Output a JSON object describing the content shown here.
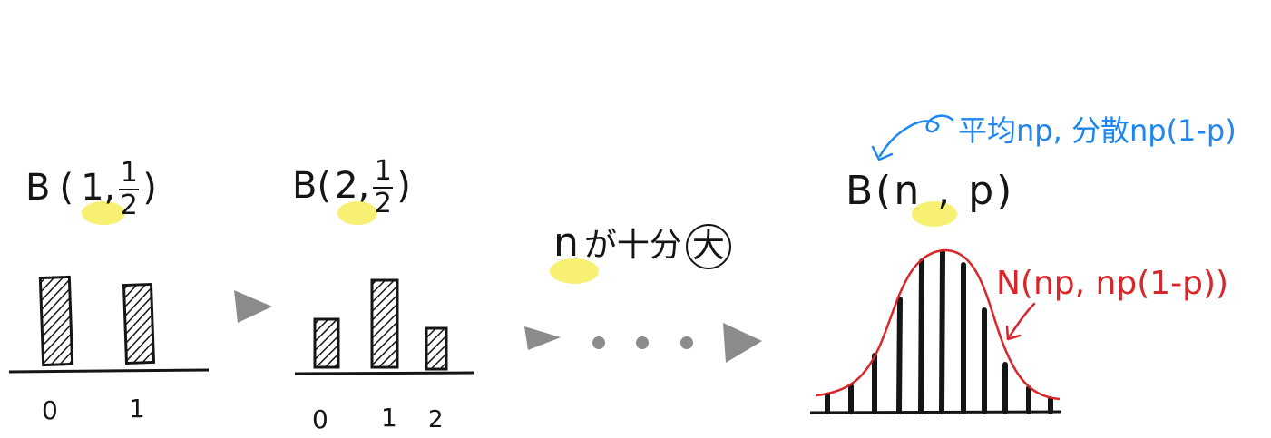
{
  "panel1": {
    "label_B": "B",
    "label_open": "(",
    "label_n": "1",
    "label_comma": ",",
    "frac_num": "1",
    "frac_den": "2",
    "label_close": ")",
    "ticks": [
      "0",
      "1"
    ]
  },
  "panel2": {
    "label_B": "B",
    "label_open": "(",
    "label_n": "2",
    "label_comma": ",",
    "frac_num": "1",
    "frac_den": "2",
    "label_close": ")",
    "ticks": [
      "0",
      "1",
      "2"
    ]
  },
  "middle": {
    "n": "n",
    "text": "が十分",
    "circled": "大"
  },
  "panel3": {
    "label": "B(n , p)",
    "note_blue": "平均np, 分散np(1-p)",
    "normal_label": "N(np, np(1-p))"
  },
  "colors": {
    "ink": "#151515",
    "highlight": "#f7ef6a",
    "blue": "#1d86f0",
    "red": "#d8262a",
    "arrow_gray": "#8b8b8b"
  }
}
